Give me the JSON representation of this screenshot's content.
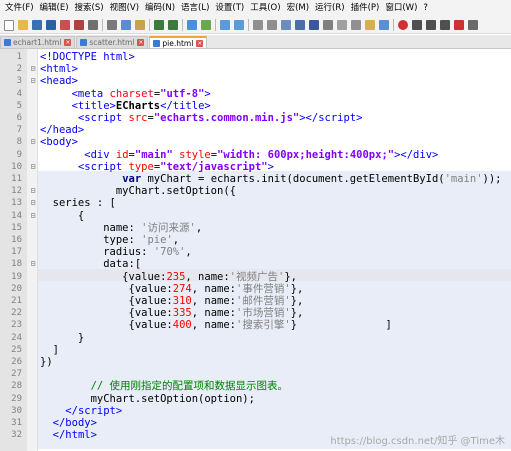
{
  "menu": [
    "文件(F)",
    "编辑(E)",
    "搜索(S)",
    "视图(V)",
    "编码(N)",
    "语言(L)",
    "设置(T)",
    "工具(O)",
    "宏(M)",
    "运行(R)",
    "插件(P)",
    "窗口(W)",
    "?"
  ],
  "tabs": [
    {
      "label": "echart1.html",
      "active": false
    },
    {
      "label": "scatter.html",
      "active": false
    },
    {
      "label": "pie.html",
      "active": true
    }
  ],
  "code_lines": [
    {
      "n": "1",
      "fold": "",
      "html": "<span class='tag'>&lt;!DOCTYPE html&gt;</span>"
    },
    {
      "n": "2",
      "fold": "⊟",
      "html": "<span class='tag'>&lt;html&gt;</span>"
    },
    {
      "n": "3",
      "fold": "⊟",
      "html": "<span class='tag'>&lt;head&gt;</span>"
    },
    {
      "n": "4",
      "fold": "",
      "html": "     <span class='tag'>&lt;meta</span> <span class='attr'>charset</span>=<span class='str'>\"utf-8\"</span><span class='tag'>&gt;</span>"
    },
    {
      "n": "5",
      "fold": "",
      "html": "     <span class='tag'>&lt;title&gt;</span><span class='dt'>ECharts</span><span class='tag'>&lt;/title&gt;</span>"
    },
    {
      "n": "6",
      "fold": "",
      "html": "      <span class='tag'>&lt;script</span> <span class='attr'>src</span>=<span class='str'>\"echarts.common.min.js\"</span><span class='tag'>&gt;&lt;/script&gt;</span>"
    },
    {
      "n": "7",
      "fold": "",
      "html": "<span class='tag'>&lt;/head&gt;</span>"
    },
    {
      "n": "8",
      "fold": "⊟",
      "html": "<span class='tag'>&lt;body&gt;</span>"
    },
    {
      "n": "9",
      "fold": "",
      "html": "       <span class='tag'>&lt;div</span> <span class='attr'>id</span>=<span class='str'>\"main\"</span> <span class='attr'>style</span>=<span class='str'>\"width: 600px;height:400px;\"</span><span class='tag'>&gt;&lt;/div&gt;</span>"
    },
    {
      "n": "10",
      "fold": "⊟",
      "html": "      <span class='tag'>&lt;script</span> <span class='attr'>type</span>=<span class='str'>\"text/javascript\"</span><span class='tag'>&gt;</span>"
    },
    {
      "n": "11",
      "fold": "",
      "html": "             <span class='kw'>var</span> myChart = echarts.init(document.getElementById(<span class='jstr'>'main'</span>));"
    },
    {
      "n": "12",
      "fold": "⊟",
      "html": "            myChart.setOption({"
    },
    {
      "n": "13",
      "fold": "⊟",
      "html": "  series : ["
    },
    {
      "n": "14",
      "fold": "⊟",
      "html": "      {"
    },
    {
      "n": "15",
      "fold": "",
      "html": "          name: <span class='jstr'>'访问来源'</span>,"
    },
    {
      "n": "16",
      "fold": "",
      "html": "          type: <span class='jstr'>'pie'</span>,"
    },
    {
      "n": "17",
      "fold": "",
      "html": "          radius: <span class='jstr'>'70%'</span>,"
    },
    {
      "n": "18",
      "fold": "⊟",
      "html": "          data:["
    },
    {
      "n": "19",
      "fold": "",
      "html": "             {value:<span class='num'>235</span>, name:<span class='jstr'>'视频广告'</span>},"
    },
    {
      "n": "20",
      "fold": "",
      "html": "              {value:<span class='num'>274</span>, name:<span class='jstr'>'事件营销'</span>},"
    },
    {
      "n": "21",
      "fold": "",
      "html": "              {value:<span class='num'>310</span>, name:<span class='jstr'>'邮件营销'</span>},"
    },
    {
      "n": "22",
      "fold": "",
      "html": "              {value:<span class='num'>335</span>, name:<span class='jstr'>'市场营销'</span>},"
    },
    {
      "n": "23",
      "fold": "",
      "html": "              {value:<span class='num'>400</span>, name:<span class='jstr'>'搜索引擎'</span>}              ]"
    },
    {
      "n": "24",
      "fold": "",
      "html": "      }"
    },
    {
      "n": "25",
      "fold": "",
      "html": "  ]"
    },
    {
      "n": "26",
      "fold": "",
      "html": "})"
    },
    {
      "n": "27",
      "fold": "",
      "html": ""
    },
    {
      "n": "28",
      "fold": "",
      "html": "        <span class='cmt'>// 使用刚指定的配置项和数据显示图表。</span>"
    },
    {
      "n": "29",
      "fold": "",
      "html": "        myChart.setOption(option);"
    },
    {
      "n": "30",
      "fold": "",
      "html": "    <span class='tag'>&lt;/script&gt;</span>"
    },
    {
      "n": "31",
      "fold": "",
      "html": "  <span class='tag'>&lt;/body&gt;</span>"
    },
    {
      "n": "32",
      "fold": "",
      "html": "  <span class='tag'>&lt;/html&gt;</span>"
    }
  ],
  "watermark": "https://blog.csdn.net/知乎 @Time木"
}
